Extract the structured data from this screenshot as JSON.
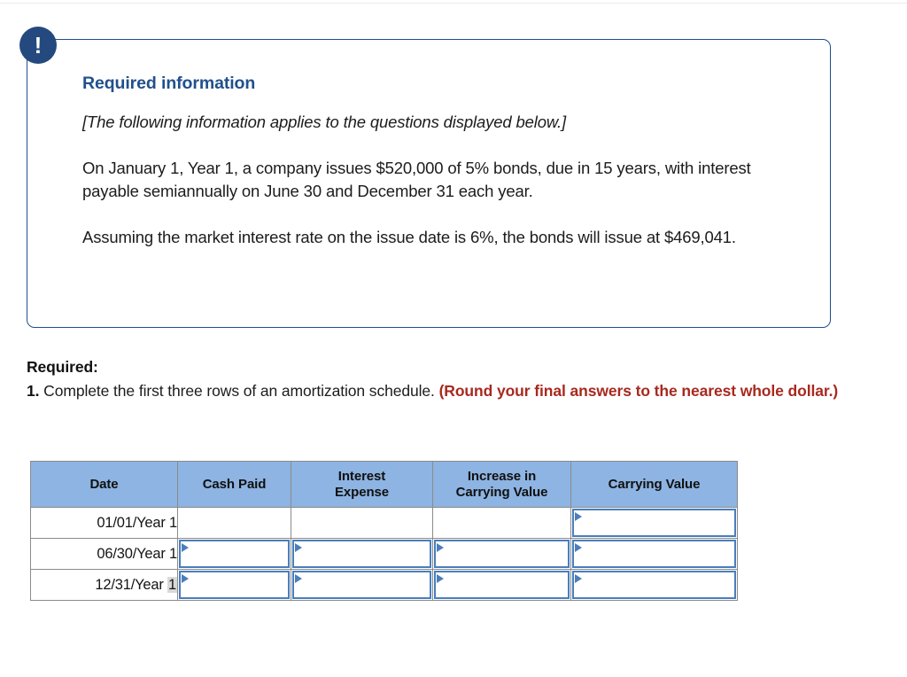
{
  "callout": {
    "icon": "exclamation-icon",
    "badge_glyph": "!",
    "title": "Required information",
    "note": "[The following information applies to the questions displayed below.]",
    "paragraph_1": "On January 1, Year 1, a company issues $520,000 of 5% bonds, due in 15 years, with interest payable semiannually on June 30 and December 31 each year.",
    "paragraph_2": "Assuming the market interest rate on the issue date is 6%, the bonds will issue at $469,041.",
    "border_color": "#1f4e8c",
    "title_color": "#21508c",
    "badge_color": "#24497f"
  },
  "required": {
    "label": "Required:",
    "item_number": "1.",
    "item_text": " Complete the first three rows of an amortization schedule. ",
    "emphasis": "(Round your final answers to the nearest whole dollar.)",
    "emphasis_color": "#a8291f"
  },
  "table": {
    "header_bg": "#8db4e2",
    "input_border_color": "#4a7ebb",
    "columns": [
      "Date",
      "Cash Paid",
      "Interest Expense",
      "Increase in Carrying Value",
      "Carrying Value"
    ],
    "columns_wrapped": [
      [
        "Date"
      ],
      [
        "Cash Paid"
      ],
      [
        "Interest",
        "Expense"
      ],
      [
        "Increase in",
        "Carrying Value"
      ],
      [
        "Carrying Value"
      ]
    ],
    "rows": [
      {
        "date_prefix": "01/01/Year ",
        "date_highlight": "",
        "date_suffix": "1",
        "cash_paid": "",
        "interest_expense": "",
        "increase_in_carrying_value": "",
        "carrying_value": ""
      },
      {
        "date_prefix": "06/30/Year ",
        "date_highlight": "",
        "date_suffix": "1",
        "cash_paid": "",
        "interest_expense": "",
        "increase_in_carrying_value": "",
        "carrying_value": ""
      },
      {
        "date_prefix": "12/31/Year ",
        "date_highlight": "1",
        "date_suffix": "",
        "cash_paid": "",
        "interest_expense": "",
        "increase_in_carrying_value": "",
        "carrying_value": ""
      }
    ]
  }
}
